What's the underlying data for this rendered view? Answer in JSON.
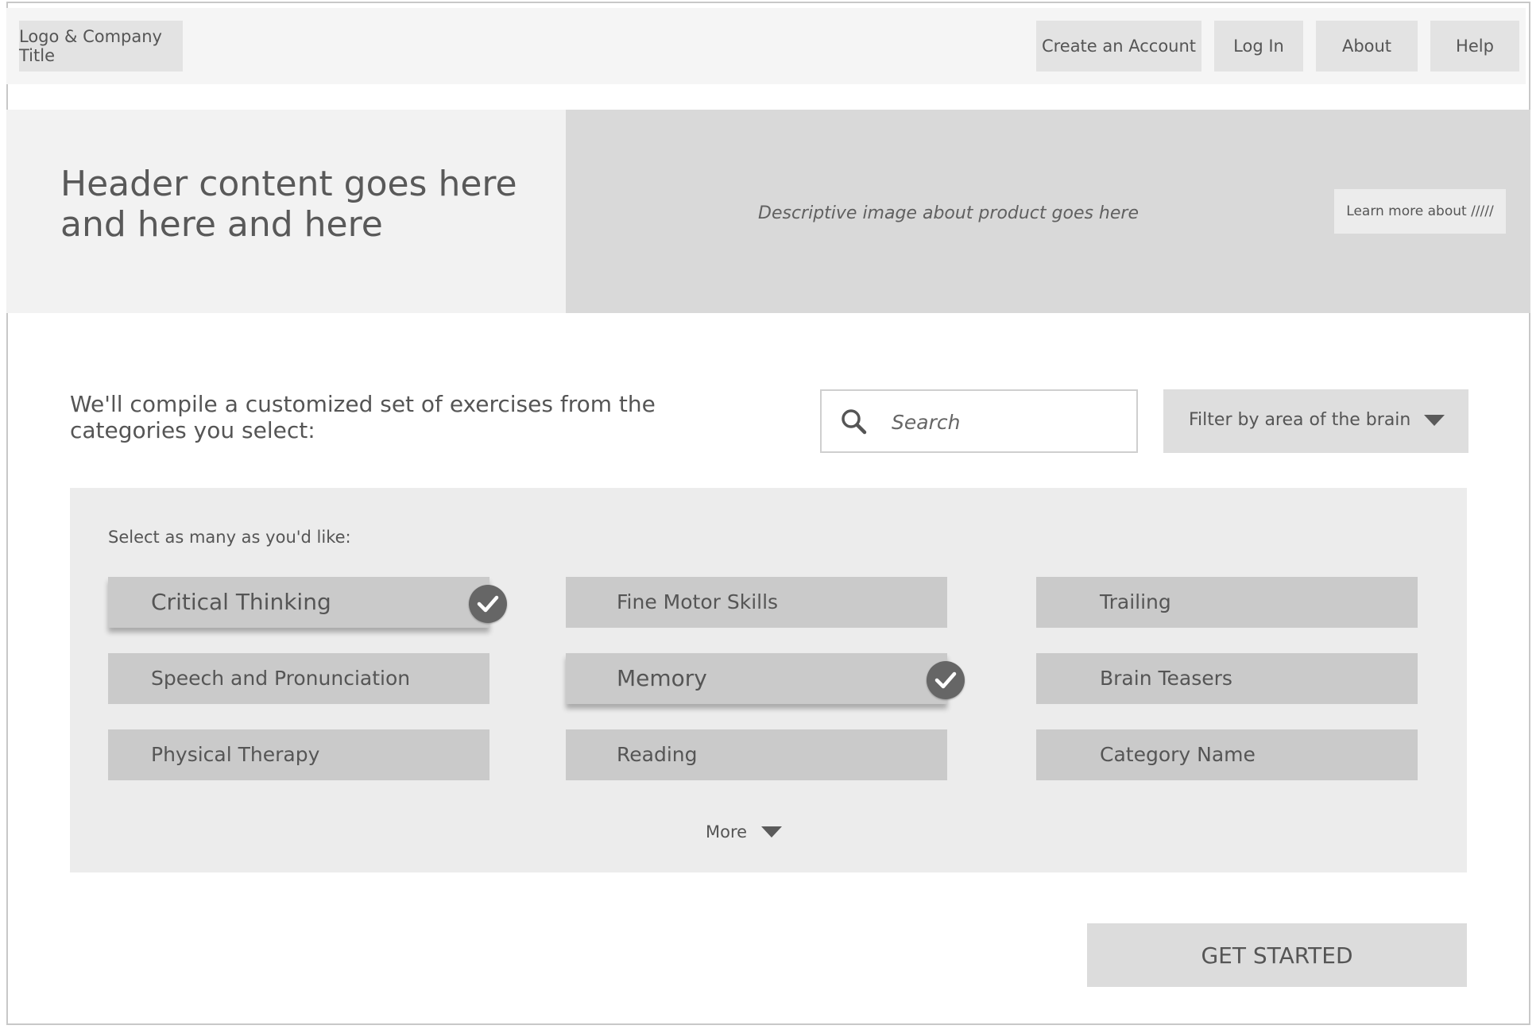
{
  "nav": {
    "logo": "Logo & Company Title",
    "links": [
      "Create an Account",
      "Log In",
      "About",
      "Help"
    ]
  },
  "hero": {
    "title": "Header content goes here and here and here",
    "image_caption": "Descriptive image about product goes here",
    "learn_more": "Learn more about /////"
  },
  "intro": {
    "text": "We'll compile a customized set of exercises from the categories you select:"
  },
  "search": {
    "placeholder": "Search",
    "icon": "search-icon"
  },
  "filter": {
    "label": "Filter by area of the brain",
    "icon": "caret-down-icon"
  },
  "categories": {
    "instruction": "Select as many as you'd like:",
    "items": [
      {
        "label": "Critical Thinking",
        "selected": true
      },
      {
        "label": "Fine Motor Skills",
        "selected": false
      },
      {
        "label": "Trailing",
        "selected": false
      },
      {
        "label": "Speech and Pronunciation",
        "selected": false
      },
      {
        "label": "Memory",
        "selected": true
      },
      {
        "label": "Brain Teasers",
        "selected": false
      },
      {
        "label": "Physical Therapy",
        "selected": false
      },
      {
        "label": "Reading",
        "selected": false
      },
      {
        "label": "Category Name",
        "selected": false
      }
    ],
    "more_label": "More"
  },
  "cta": {
    "label": "GET STARTED"
  },
  "colors": {
    "nav_bg": "#f5f5f5",
    "button_bg": "#e3e3e3",
    "hero_left_bg": "#f2f2f2",
    "hero_right_bg": "#d9d9d9",
    "panel_bg": "#ececec",
    "category_bg": "#cacaca",
    "check_bg": "#666666",
    "text": "#555555"
  }
}
